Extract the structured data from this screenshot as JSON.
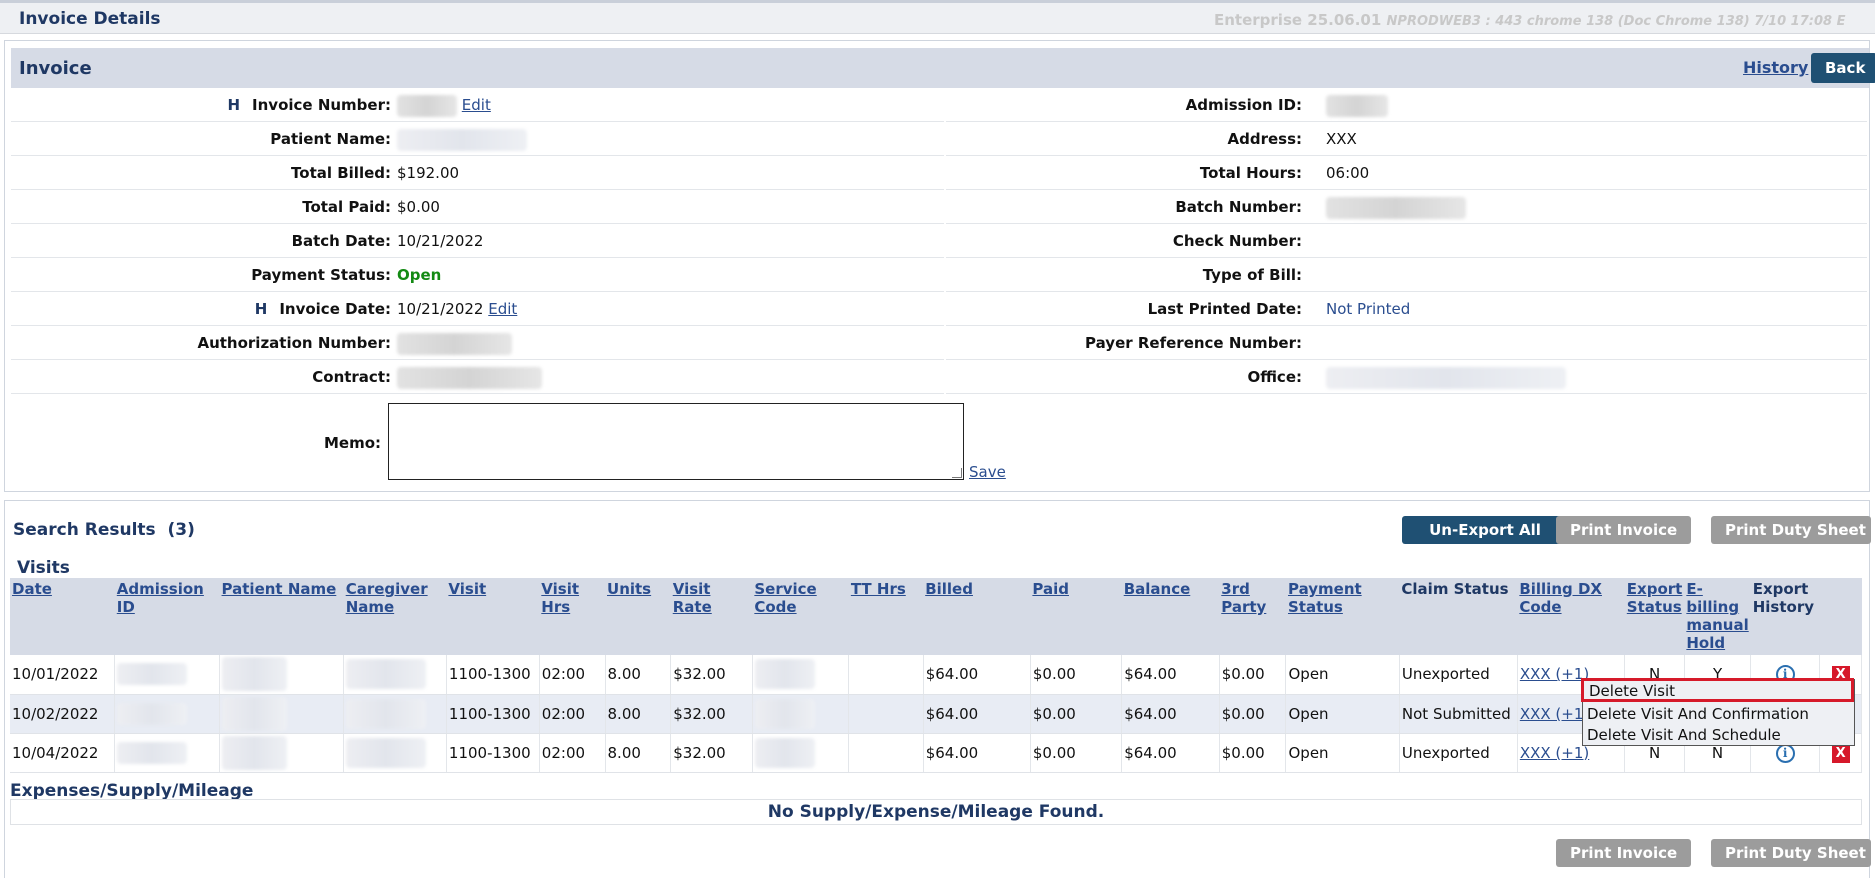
{
  "topbar": {
    "title": "Invoice Details",
    "env_version": "Enterprise 25.06.01",
    "env_details": "NPRODWEB3 : 443 chrome 138 (Doc Chrome 138) 7/10 17:08 E"
  },
  "invoice": {
    "title": "Invoice",
    "history_label": "History",
    "back_label": "Back",
    "edit_label": "Edit",
    "h_mark": "H",
    "left_fields": [
      {
        "label": "Invoice Number:",
        "value": ""
      },
      {
        "label": "Patient Name:",
        "value": ""
      },
      {
        "label": "Total Billed:",
        "value": "$192.00"
      },
      {
        "label": "Total Paid:",
        "value": "$0.00"
      },
      {
        "label": "Batch Date:",
        "value": "10/21/2022"
      },
      {
        "label": "Payment Status:",
        "value": "Open"
      },
      {
        "label": "Invoice Date:",
        "value": "10/21/2022"
      },
      {
        "label": "Authorization Number:",
        "value": ""
      },
      {
        "label": "Contract:",
        "value": ""
      }
    ],
    "right_fields": [
      {
        "label": "Admission ID:",
        "value": ""
      },
      {
        "label": "Address:",
        "value": "XXX"
      },
      {
        "label": "Total Hours:",
        "value": "06:00"
      },
      {
        "label": "Batch Number:",
        "value": ""
      },
      {
        "label": "Check Number:",
        "value": ""
      },
      {
        "label": "Type of Bill:",
        "value": ""
      },
      {
        "label": "Last Printed Date:",
        "value": "Not Printed"
      },
      {
        "label": "Payer Reference Number:",
        "value": ""
      },
      {
        "label": "Office:",
        "value": ""
      }
    ],
    "memo_label": "Memo:",
    "memo_value": "",
    "save_label": "Save"
  },
  "search": {
    "title": "Search Results",
    "count": "(3)",
    "unexport_all_label": "Un-Export All",
    "print_invoice_label": "Print Invoice",
    "print_duty_sheet_label": "Print Duty Sheet",
    "visits_title": "Visits"
  },
  "visits_table": {
    "headers": [
      "Date",
      "Admission ID",
      "Patient Name",
      "Caregiver Name",
      "Visit",
      "Visit Hrs",
      "Units",
      "Visit Rate",
      "Service Code",
      "TT Hrs",
      "Billed",
      "Paid",
      "Balance",
      "3rd Party",
      "Payment Status",
      "Claim Status",
      "Billing DX Code",
      "Export Status",
      "E-billing manual Hold",
      "Export History"
    ],
    "rows": [
      {
        "date": "10/01/2022",
        "visit": "1100-1300",
        "visit_hrs": "02:00",
        "units": "8.00",
        "visit_rate": "$32.00",
        "tt_hrs": "",
        "billed": "$64.00",
        "paid": "$0.00",
        "balance": "$64.00",
        "third_party": "$0.00",
        "payment_status": "Open",
        "claim_status": "Unexported",
        "billing_dx": "XXX (+1)",
        "export_status": "N",
        "ebilling_hold": "Y"
      },
      {
        "date": "10/02/2022",
        "visit": "1100-1300",
        "visit_hrs": "02:00",
        "units": "8.00",
        "visit_rate": "$32.00",
        "tt_hrs": "",
        "billed": "$64.00",
        "paid": "$0.00",
        "balance": "$64.00",
        "third_party": "$0.00",
        "payment_status": "Open",
        "claim_status": "Not Submitted",
        "billing_dx": "XXX (+1)",
        "export_status": "",
        "ebilling_hold": ""
      },
      {
        "date": "10/04/2022",
        "visit": "1100-1300",
        "visit_hrs": "02:00",
        "units": "8.00",
        "visit_rate": "$32.00",
        "tt_hrs": "",
        "billed": "$64.00",
        "paid": "$0.00",
        "balance": "$64.00",
        "third_party": "$0.00",
        "payment_status": "Open",
        "claim_status": "Unexported",
        "billing_dx": "XXX (+1)",
        "export_status": "N",
        "ebilling_hold": "N"
      }
    ],
    "info_glyph": "i",
    "delete_glyph": "X"
  },
  "context_menu": {
    "items": [
      "Delete Visit",
      "Delete Visit And Confirmation",
      "Delete Visit And Schedule"
    ]
  },
  "expenses": {
    "title": "Expenses/Supply/Mileage",
    "empty_text": "No Supply/Expense/Mileage Found."
  },
  "icons": {
    "info": "info-icon",
    "delete": "delete-icon"
  },
  "colors": {
    "primary_button": "#1f5073",
    "disabled_button": "#9c9c9c",
    "header_band": "#d6dbe6",
    "open_status": "#138a13",
    "delete_highlight": "#d61a2a"
  }
}
